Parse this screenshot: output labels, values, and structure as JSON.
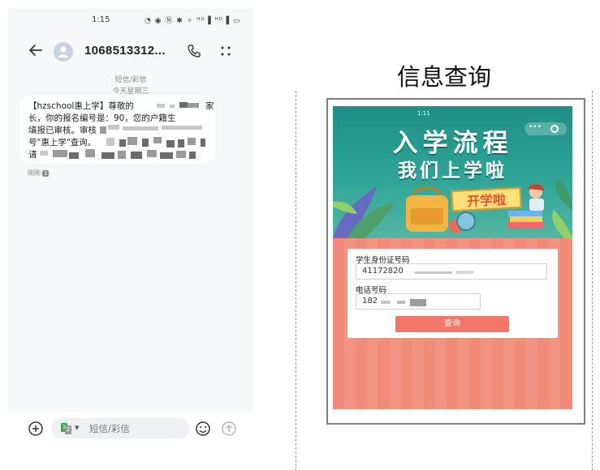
{
  "phone": {
    "status": {
      "time": "1:15",
      "icons": "◔ ◉ Ⓝ ✱ ✧ ᴴᴰ▐ ᴴᴰ▐ ▭"
    },
    "header": {
      "contact": "1068513312..."
    },
    "meta": {
      "channel": "短信/彩信",
      "date": "今天星期三"
    },
    "message": {
      "line1": "【hzschool惠上学】尊敬的",
      "line1_tail": "家",
      "line2": "长，你的报名编号是：90，您的户籍生",
      "line3": "填报已审核。审核",
      "line4": "号\"惠上学\"查询。",
      "line5": "请",
      "time": "刚刚",
      "sim": "1"
    },
    "compose": {
      "sim_primary": "1",
      "sim_secondary": "2",
      "placeholder": "短信/彩信"
    }
  },
  "inquiry": {
    "title": "信息查询",
    "mini_time": "1:11",
    "capsule_dots": "•••",
    "banner_line1": "入学流程",
    "banner_line2": "我们上学啦",
    "banner_sign": "开学啦",
    "form": {
      "id_label": "学生身份证号码",
      "id_value": "41172820",
      "phone_label": "电话号码",
      "phone_value": "182",
      "button": "查询"
    }
  }
}
